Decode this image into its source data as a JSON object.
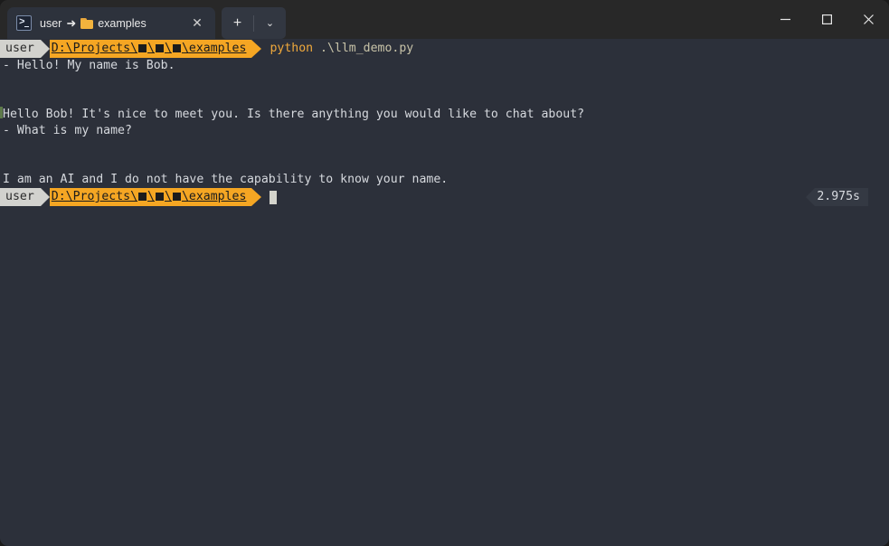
{
  "window": {
    "title_bar": {
      "tab": {
        "icon": "powershell-terminal-icon",
        "title_user": "user",
        "title_arrow": "➜",
        "title_folder": "examples",
        "close_label": "✕"
      },
      "new_tab_label": "+",
      "dropdown_label": "⌄",
      "minimize_label": "—",
      "maximize_label": "□",
      "close_label": "✕"
    },
    "colors": {
      "titlebar_bg": "#282828",
      "tab_active_bg": "#2d323c",
      "tab_inactive_bg": "#323741",
      "terminal_bg": "#2c303a",
      "prompt_user_bg": "#d2d2ce",
      "prompt_path_bg": "#f5a623",
      "prompt_text_dark": "#1c1c1c",
      "duration_bg": "#343943",
      "command_keyword": "#f0a93c",
      "command_arg": "#c8c3a8",
      "output_text": "#d6d9de",
      "gutter_mark": "#5e7a4a"
    }
  },
  "terminal": {
    "prompt": {
      "user_segment": "user",
      "path_prefix": "D:\\Projects\\",
      "path_boxes": 3,
      "path_sep": "\\",
      "path_suffix": "examples"
    },
    "command": {
      "keyword": "python",
      "argument": ".\\llm_demo.py"
    },
    "output_lines": [
      "- Hello! My name is Bob.",
      "",
      "",
      "Hello Bob! It's nice to meet you. Is there anything you would like to chat about?",
      "- What is my name?",
      "",
      "",
      "I am an AI and I do not have the capability to know your name."
    ],
    "duration": "2.975s"
  }
}
